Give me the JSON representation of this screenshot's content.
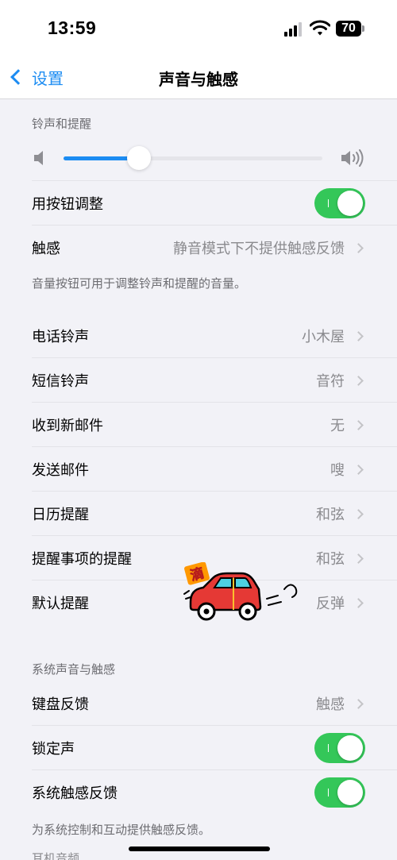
{
  "status": {
    "time": "13:59",
    "battery": "70"
  },
  "nav": {
    "back_label": "设置",
    "title": "声音与触感"
  },
  "ringer": {
    "header": "铃声和提醒",
    "volume_level": 0.29,
    "adjust_label": "用按钮调整",
    "adjust_on": true,
    "haptics_label": "触感",
    "haptics_value": "静音模式下不提供触感反馈",
    "footer": "音量按钮可用于调整铃声和提醒的音量。"
  },
  "tones": [
    {
      "label": "电话铃声",
      "value": "小木屋"
    },
    {
      "label": "短信铃声",
      "value": "音符"
    },
    {
      "label": "收到新邮件",
      "value": "无"
    },
    {
      "label": "发送邮件",
      "value": "嗖"
    },
    {
      "label": "日历提醒",
      "value": "和弦"
    },
    {
      "label": "提醒事项的提醒",
      "value": "和弦"
    },
    {
      "label": "默认提醒",
      "value": "反弹"
    }
  ],
  "system": {
    "header": "系统声音与触感",
    "keyboard_label": "键盘反馈",
    "keyboard_value": "触感",
    "lock_label": "锁定声",
    "lock_on": true,
    "haptic_label": "系统触感反馈",
    "haptic_on": true,
    "footer": "为系统控制和互动提供触感反馈。"
  },
  "next_section_header": "耳机音频",
  "sticker_text": "滴",
  "colors": {
    "accent": "#1c8cf2",
    "toggle_on": "#34c759",
    "car": "#e53935"
  }
}
